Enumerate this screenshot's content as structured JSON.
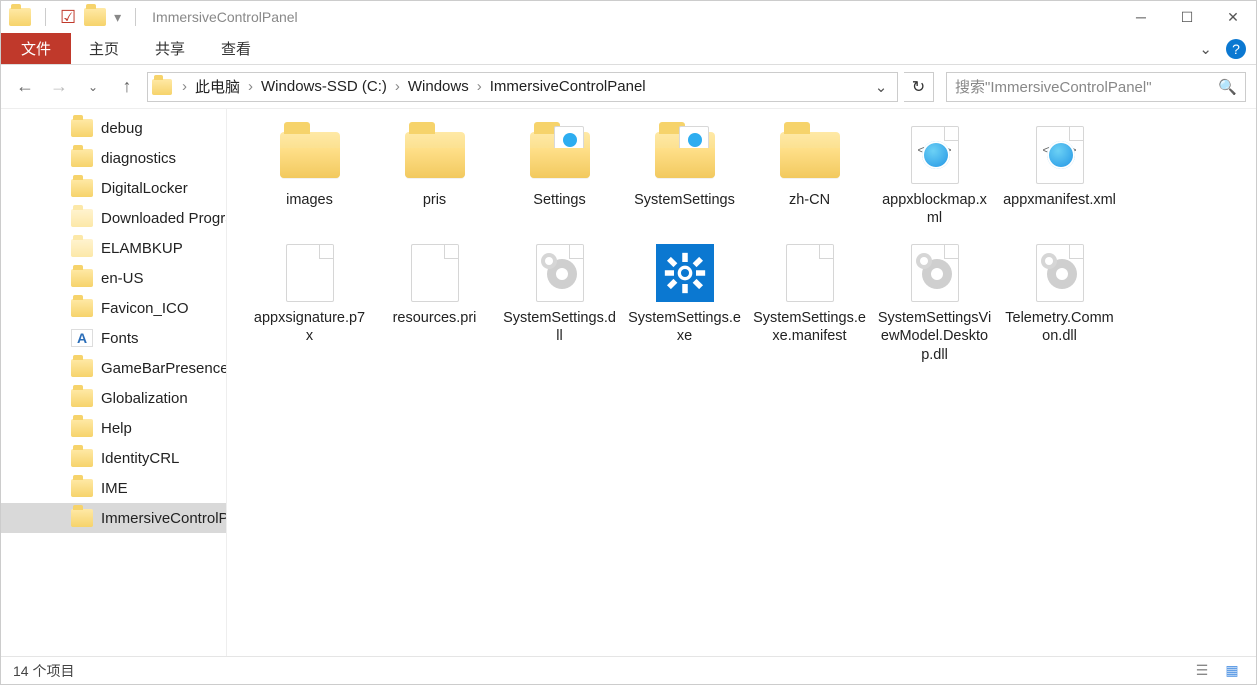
{
  "title": "ImmersiveControlPanel",
  "ribbon": {
    "file": "文件",
    "tabs": [
      "主页",
      "共享",
      "查看"
    ]
  },
  "breadcrumbs": [
    "此电脑",
    "Windows-SSD (C:)",
    "Windows",
    "ImmersiveControlPanel"
  ],
  "search_placeholder": "搜索\"ImmersiveControlPanel\"",
  "tree": [
    {
      "label": "debug",
      "icon": "folder"
    },
    {
      "label": "diagnostics",
      "icon": "folder"
    },
    {
      "label": "DigitalLocker",
      "icon": "folder"
    },
    {
      "label": "Downloaded Program Files",
      "icon": "folder-pale"
    },
    {
      "label": "ELAMBKUP",
      "icon": "folder-pale"
    },
    {
      "label": "en-US",
      "icon": "folder"
    },
    {
      "label": "Favicon_ICO",
      "icon": "folder"
    },
    {
      "label": "Fonts",
      "icon": "fonts"
    },
    {
      "label": "GameBarPresenceWriter",
      "icon": "folder"
    },
    {
      "label": "Globalization",
      "icon": "folder"
    },
    {
      "label": "Help",
      "icon": "folder"
    },
    {
      "label": "IdentityCRL",
      "icon": "folder"
    },
    {
      "label": "IME",
      "icon": "folder"
    },
    {
      "label": "ImmersiveControlPanel",
      "icon": "folder",
      "selected": true
    }
  ],
  "items": [
    {
      "name": "images",
      "type": "folder"
    },
    {
      "name": "pris",
      "type": "folder"
    },
    {
      "name": "Settings",
      "type": "folder-doc"
    },
    {
      "name": "SystemSettings",
      "type": "folder-doc"
    },
    {
      "name": "zh-CN",
      "type": "folder"
    },
    {
      "name": "appxblockmap.xml",
      "type": "xml"
    },
    {
      "name": "appxmanifest.xml",
      "type": "xml"
    },
    {
      "name": "appxsignature.p7x",
      "type": "blank"
    },
    {
      "name": "resources.pri",
      "type": "blank"
    },
    {
      "name": "SystemSettings.dll",
      "type": "dll"
    },
    {
      "name": "SystemSettings.exe",
      "type": "exe"
    },
    {
      "name": "SystemSettings.exe.manifest",
      "type": "blank"
    },
    {
      "name": "SystemSettingsViewModel.Desktop.dll",
      "type": "dll"
    },
    {
      "name": "Telemetry.Common.dll",
      "type": "dll"
    }
  ],
  "status": "14 个项目"
}
